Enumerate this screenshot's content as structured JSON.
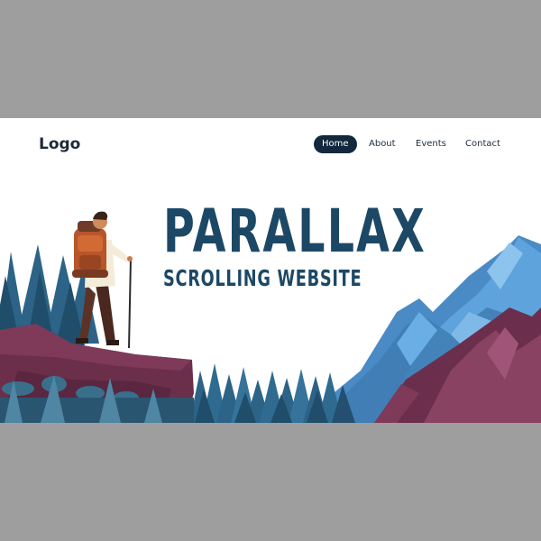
{
  "header": {
    "logo": "Logo",
    "nav": [
      {
        "label": "Home",
        "active": true
      },
      {
        "label": "About",
        "active": false
      },
      {
        "label": "Events",
        "active": false
      },
      {
        "label": "Contact",
        "active": false
      }
    ]
  },
  "hero": {
    "title": "PARALLAX",
    "subtitle": "SCROLLING WEBSITE"
  },
  "colors": {
    "backdrop": "#9e9e9e",
    "navy": "#1c4866",
    "nav_active_bg": "#13283d",
    "mountain_blue": "#5a9bd6",
    "mountain_maroon": "#7a3a55",
    "rock": "#6b2f4a",
    "tree": "#2c6386",
    "tree_dark": "#1f4d6a"
  },
  "icons": [
    "hiker-illustration",
    "mountain-range",
    "pine-forest",
    "rock-cliff"
  ]
}
